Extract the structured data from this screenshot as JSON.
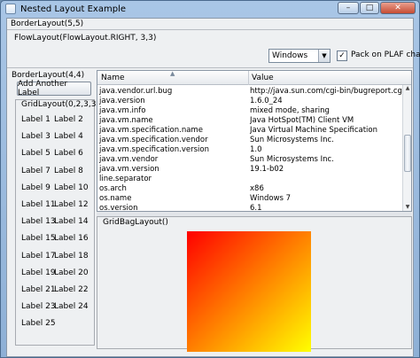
{
  "window": {
    "title": "Nested Layout Example"
  },
  "panels": {
    "border_outer": "BorderLayout(5,5)",
    "flow": "FlowLayout(FlowLayout.RIGHT, 3,3)",
    "border_inner": "BorderLayout(4,4)",
    "grid": "GridLayout(0,2,3,3)",
    "gridbag": "GridBagLayout()"
  },
  "toolbar": {
    "plaf_select": {
      "value": "Windows"
    },
    "pack_checkbox": {
      "label": "Pack on PLAF change",
      "checked": true
    }
  },
  "sidebar": {
    "add_button": "Add Another Label",
    "labels": [
      "Label 1",
      "Label 2",
      "Label 3",
      "Label 4",
      "Label 5",
      "Label 6",
      "Label 7",
      "Label 8",
      "Label 9",
      "Label 10",
      "Label 11",
      "Label 12",
      "Label 13",
      "Label 14",
      "Label 15",
      "Label 16",
      "Label 17",
      "Label 18",
      "Label 19",
      "Label 20",
      "Label 21",
      "Label 22",
      "Label 23",
      "Label 24",
      "Label 25"
    ]
  },
  "table": {
    "columns": [
      "Name",
      "Value"
    ],
    "rows": [
      [
        "java.vendor.url.bug",
        "http://java.sun.com/cgi-bin/bugreport.cgi"
      ],
      [
        "java.version",
        "1.6.0_24"
      ],
      [
        "java.vm.info",
        "mixed mode, sharing"
      ],
      [
        "java.vm.name",
        "Java HotSpot(TM) Client VM"
      ],
      [
        "java.vm.specification.name",
        "Java Virtual Machine Specification"
      ],
      [
        "java.vm.specification.vendor",
        "Sun Microsystems Inc."
      ],
      [
        "java.vm.specification.version",
        "1.0"
      ],
      [
        "java.vm.vendor",
        "Sun Microsystems Inc."
      ],
      [
        "java.vm.version",
        "19.1-b02"
      ],
      [
        "line.separator",
        ""
      ],
      [
        "os.arch",
        "x86"
      ],
      [
        "os.name",
        "Windows 7"
      ],
      [
        "os.version",
        "6.1"
      ]
    ]
  },
  "colors": {
    "gradient_start": "#ff0000",
    "gradient_mid": "#ff8000",
    "gradient_end": "#ffff00",
    "titlebar": "#a9c6e6"
  },
  "icons": {
    "app": "java-frame-icon",
    "minimize": "minimize-icon",
    "maximize": "maximize-icon",
    "close": "close-icon",
    "dropdown": "chevron-down-icon",
    "sort": "sort-ascending-icon"
  }
}
